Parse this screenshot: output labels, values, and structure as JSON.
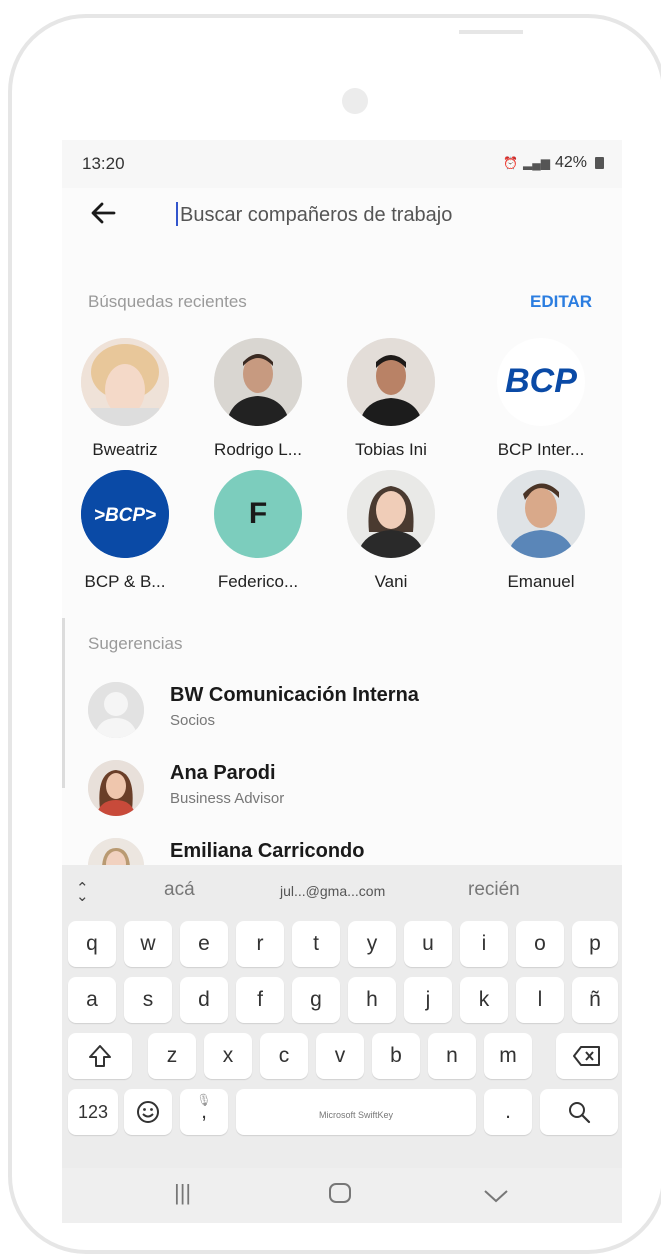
{
  "status_bar": {
    "time": "13:20",
    "battery": "42%"
  },
  "search": {
    "placeholder": "Buscar compañeros de trabajo"
  },
  "recent": {
    "title": "Búsquedas recientes",
    "edit_label": "EDITAR",
    "items": [
      {
        "name": "Bweatriz"
      },
      {
        "name": "Rodrigo L..."
      },
      {
        "name": "Tobias Ini"
      },
      {
        "name": "BCP Inter...",
        "logo_text": "BCP"
      },
      {
        "name": "BCP & B...",
        "logo_text": ">BCP>"
      },
      {
        "name": "Federico...",
        "initial": "F"
      },
      {
        "name": "Vani"
      },
      {
        "name": "Emanuel"
      }
    ]
  },
  "suggestions": {
    "title": "Sugerencias",
    "items": [
      {
        "name": "BW Comunicación Interna",
        "subtitle": "Socios"
      },
      {
        "name": "Ana Parodi",
        "subtitle": "Business Advisor"
      },
      {
        "name": "Emiliana Carricondo",
        "subtitle": ""
      }
    ]
  },
  "keyboard": {
    "suggestions": [
      "acá",
      "jul...@gma...com",
      "recién"
    ],
    "row1": [
      "q",
      "w",
      "e",
      "r",
      "t",
      "y",
      "u",
      "i",
      "o",
      "p"
    ],
    "row2": [
      "a",
      "s",
      "d",
      "f",
      "g",
      "h",
      "j",
      "k",
      "l",
      "ñ"
    ],
    "row3": [
      "z",
      "x",
      "c",
      "v",
      "b",
      "n",
      "m"
    ],
    "numbers_label": "123",
    "space_label": "Microsoft SwiftKey",
    "comma_label": ",",
    "period_label": "."
  },
  "colors": {
    "accent": "#2b7de0",
    "bcp_blue": "#0a4aa6",
    "federico_bg": "#7ccdbd"
  }
}
